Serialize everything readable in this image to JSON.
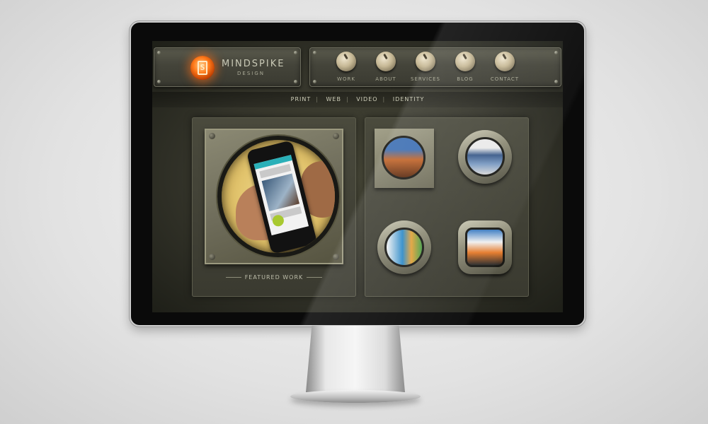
{
  "brand": {
    "name": "MINDSPIKE",
    "sub": "DESIGN",
    "logo_glyph": "S",
    "logo_color": "#ff7a1a"
  },
  "main_nav": [
    {
      "label": "WORK"
    },
    {
      "label": "ABOUT"
    },
    {
      "label": "SERVICES"
    },
    {
      "label": "BLOG"
    },
    {
      "label": "CONTACT"
    }
  ],
  "sub_nav": [
    {
      "label": "PRINT"
    },
    {
      "label": "WEB"
    },
    {
      "label": "VIDEO"
    },
    {
      "label": "IDENTITY"
    }
  ],
  "featured": {
    "label": "FEATURED WORK"
  },
  "icons": [
    "logo-icon",
    "knob-icon",
    "bolt-icon"
  ]
}
